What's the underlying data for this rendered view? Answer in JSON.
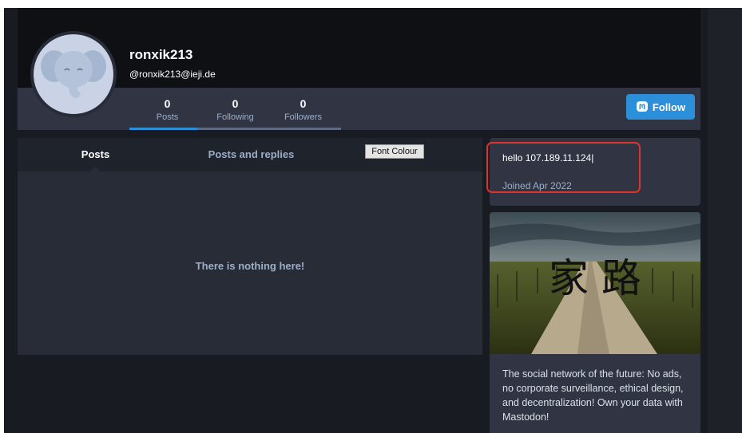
{
  "profile": {
    "display_name": "ronxik213",
    "handle": "@ronxik213@ieji.de"
  },
  "stats": [
    {
      "count": "0",
      "label": "Posts"
    },
    {
      "count": "0",
      "label": "Following"
    },
    {
      "count": "0",
      "label": "Followers"
    }
  ],
  "follow_button": {
    "label": "Follow",
    "icon": "mastodon-icon"
  },
  "tabs": [
    {
      "label": "Posts",
      "active": true
    },
    {
      "label": "Posts and replies",
      "active": false
    }
  ],
  "font_colour_button": "Font Colour",
  "empty_message": "There is nothing here!",
  "bio": {
    "text": "hello 107.189.11.124|",
    "joined": "Joined Apr 2022"
  },
  "hero": {
    "image_glyphs": "家 路",
    "description": "The social network of the future: No ads, no corporate surveillance, ethical design, and decentralization! Own your data with Mastodon!"
  },
  "colors": {
    "accent": "#2b90d9",
    "highlight": "#e0322d",
    "background": "#191b22"
  }
}
